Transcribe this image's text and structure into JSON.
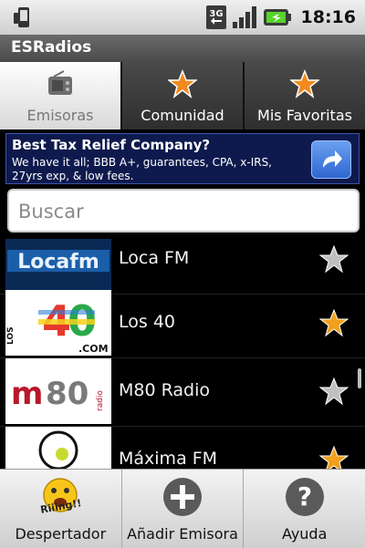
{
  "status_bar": {
    "time": "18:16",
    "network": "3G",
    "icons": [
      "phone-icon",
      "network-3g-icon",
      "signal-icon",
      "battery-icon"
    ]
  },
  "app": {
    "title": "ESRadios"
  },
  "tabs": [
    {
      "label": "Emisoras",
      "icon": "radio-icon",
      "active": true
    },
    {
      "label": "Comunidad",
      "icon": "star-icon",
      "active": false
    },
    {
      "label": "Mis Favoritas",
      "icon": "star-icon",
      "active": false
    }
  ],
  "ad": {
    "title": "Best Tax Relief Company?",
    "text": "We have it all; BBB A+, guarantees, CPA, x-IRS, 27yrs exp, & low fees.",
    "icon": "share-arrow-icon"
  },
  "search": {
    "placeholder": "Buscar",
    "value": ""
  },
  "stations": [
    {
      "name": "Loca FM",
      "favorite": false,
      "logo_text": "Locafm"
    },
    {
      "name": "Los 40",
      "favorite": true,
      "logo_text": "LOS 40 .COM"
    },
    {
      "name": "M80 Radio",
      "favorite": false,
      "logo_text": "m80 radio"
    },
    {
      "name": "Máxima FM",
      "favorite": true,
      "logo_text": ""
    }
  ],
  "bottom_bar": [
    {
      "label": "Despertador",
      "icon": "alarm-smiley-icon",
      "badge": "Riiing!!"
    },
    {
      "label": "Añadir Emisora",
      "icon": "plus-circle-icon"
    },
    {
      "label": "Ayuda",
      "icon": "help-circle-icon"
    }
  ],
  "colors": {
    "star_on": "#f2a01c",
    "star_off": "#bfbfbf",
    "ad_bg": "#0e1a4d",
    "accent": "#f28a1e"
  }
}
